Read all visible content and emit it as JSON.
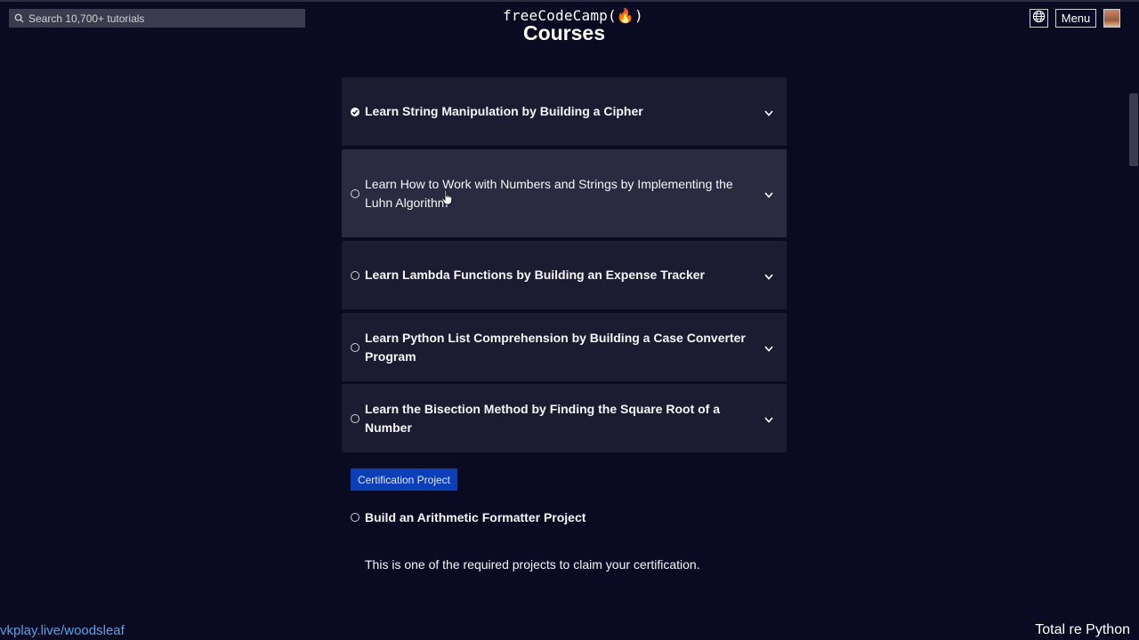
{
  "header": {
    "search_placeholder": "Search 10,700+ tutorials",
    "logo_text": "freeCodeCamp(🔥)",
    "menu_label": "Menu"
  },
  "page": {
    "title": "Courses"
  },
  "blocks": [
    {
      "label": "Learn String Manipulation by Building a Cipher",
      "completed": true
    },
    {
      "label": "Learn How to Work with Numbers and Strings by Implementing the Luhn Algorithm",
      "completed": false
    },
    {
      "label": "Learn Lambda Functions by Building an Expense Tracker",
      "completed": false
    },
    {
      "label": "Learn Python List Comprehension by Building a Case Converter Program",
      "completed": false
    },
    {
      "label": "Learn the Bisection Method by Finding the Square Root of a Number",
      "completed": false
    }
  ],
  "certification": {
    "badge": "Certification Project",
    "project_title": "Build an Arithmetic Formatter Project",
    "description": "This is one of the required projects to claim your certification."
  },
  "overlay": {
    "left_text": "vkplay.live/woodsleaf",
    "right_text": "Total re Python"
  },
  "colors": {
    "background": "#0a0a23",
    "block": "#1b1b32",
    "block_hover": "#2a2a40",
    "badge": "#0b3fb8"
  }
}
